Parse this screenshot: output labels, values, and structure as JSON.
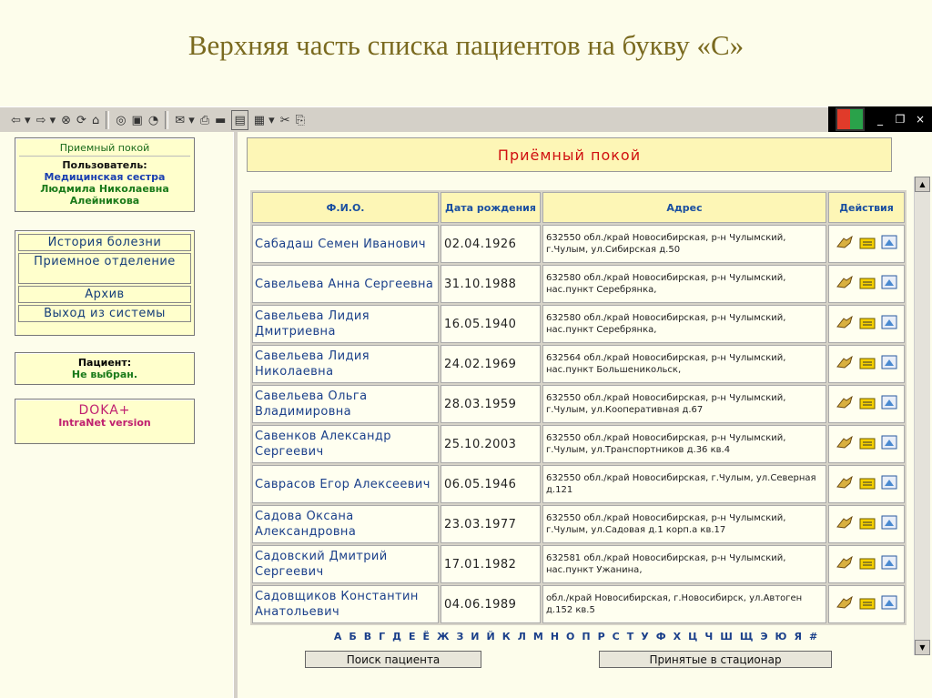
{
  "slide_title": "Верхняя часть списка пациентов на букву «С»",
  "left": {
    "title": "Приемный покой",
    "user_label": "Пользователь:",
    "user_role": "Медицинская сестра",
    "user_name": "Людмила Николаевна",
    "user_surname": "Алейникова",
    "nav": [
      "История болезни",
      "Приемное отделение",
      "Архив",
      "Выход из системы"
    ],
    "patient_label": "Пациент:",
    "patient_value": "Не выбран.",
    "product_name": "DOKA+",
    "product_sub": "IntraNet version"
  },
  "header": "Приёмный покой",
  "table": {
    "columns": [
      "Ф.И.О.",
      "Дата рождения",
      "Адрес",
      "Действия"
    ],
    "rows": [
      {
        "fio": "Сабадаш Семен Иванович",
        "dob": "02.04.1926",
        "addr": "632550 обл./край Новосибирская, р-н Чулымский, г.Чулым, ул.Сибирская д.50"
      },
      {
        "fio": "Савельева Анна Сергеевна",
        "dob": "31.10.1988",
        "addr": "632580 обл./край Новосибирская, р-н Чулымский, нас.пункт Серебрянка,"
      },
      {
        "fio": "Савельева Лидия Дмитриевна",
        "dob": "16.05.1940",
        "addr": "632580 обл./край Новосибирская, р-н Чулымский, нас.пункт Серебрянка,"
      },
      {
        "fio": "Савельева Лидия Николаевна",
        "dob": "24.02.1969",
        "addr": "632564 обл./край Новосибирская, р-н Чулымский, нас.пункт Большеникольск,"
      },
      {
        "fio": "Савельева Ольга Владимировна",
        "dob": "28.03.1959",
        "addr": "632550 обл./край Новосибирская, р-н Чулымский, г.Чулым, ул.Кооперативная д.67"
      },
      {
        "fio": "Савенков Александр Сергеевич",
        "dob": "25.10.2003",
        "addr": "632550 обл./край Новосибирская, р-н Чулымский, г.Чулым, ул.Транспортников д.36 кв.4"
      },
      {
        "fio": "Саврасов Егор Алексеевич",
        "dob": "06.05.1946",
        "addr": "632550 обл./край Новосибирская, г.Чулым, ул.Северная д.121"
      },
      {
        "fio": "Садова Оксана Александровна",
        "dob": "23.03.1977",
        "addr": "632550 обл./край Новосибирская, р-н Чулымский, г.Чулым, ул.Садовая д.1 корп.а кв.17"
      },
      {
        "fio": "Садовский Дмитрий Сергеевич",
        "dob": "17.01.1982",
        "addr": "632581 обл./край Новосибирская, р-н Чулымский, нас.пункт Ужанина,"
      },
      {
        "fio": "Садовщиков Константин Анатольевич",
        "dob": "04.06.1989",
        "addr": "обл./край Новосибирская, г.Новосибирск, ул.Автоген д.152 кв.5"
      }
    ]
  },
  "letters": [
    "А",
    "Б",
    "В",
    "Г",
    "Д",
    "Е",
    "Ё",
    "Ж",
    "З",
    "И",
    "Й",
    "К",
    "Л",
    "М",
    "Н",
    "О",
    "П",
    "Р",
    "С",
    "Т",
    "У",
    "Ф",
    "Х",
    "Ц",
    "Ч",
    "Ш",
    "Щ",
    "Э",
    "Ю",
    "Я",
    "#"
  ],
  "buttons": {
    "search": "Поиск пациента",
    "admitted": "Принятые в стационар"
  },
  "colors": {
    "panel_bg": "#ffffcc",
    "header_text": "#d01010",
    "link": "#1a3f8a"
  }
}
